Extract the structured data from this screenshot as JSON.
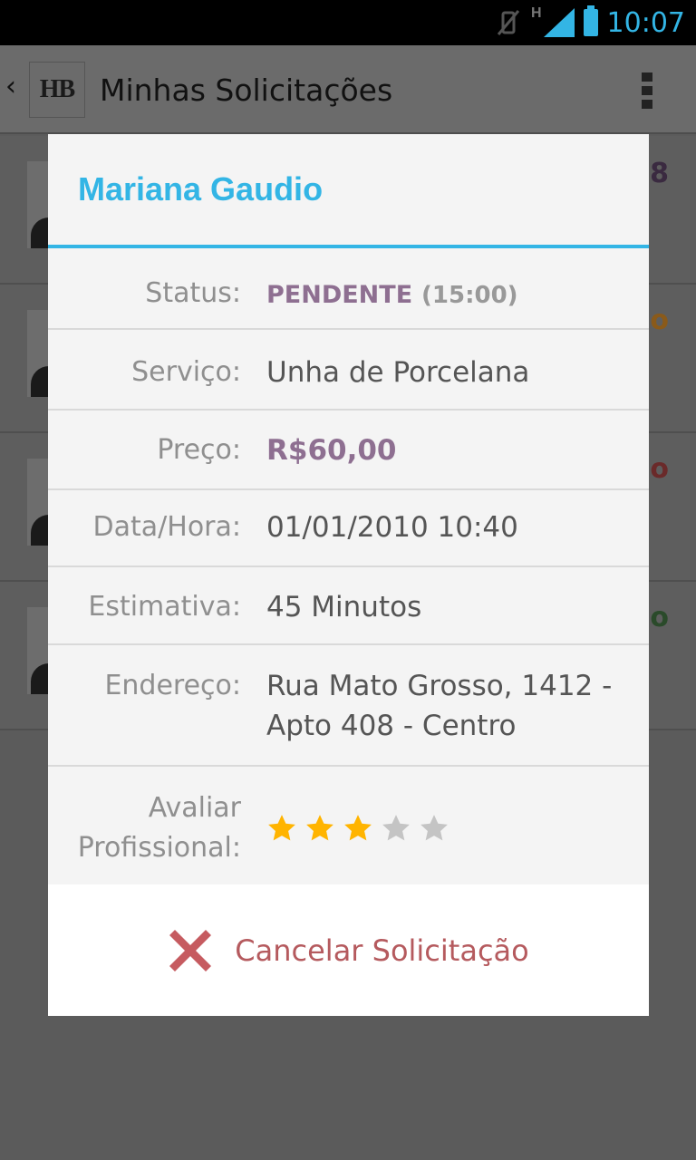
{
  "status_bar": {
    "time": "10:07",
    "network_type": "H",
    "icons": [
      "vibrate-off-icon",
      "signal-icon",
      "battery-icon"
    ]
  },
  "action_bar": {
    "logo_text": "HB",
    "title": "Minhas Solicitações",
    "icons": [
      "back-chevron-icon",
      "overflow-menu-icon"
    ]
  },
  "background_list": {
    "partial_marks": [
      "8",
      "o",
      "o",
      "o"
    ]
  },
  "dialog": {
    "title": "Mariana Gaudio",
    "fields": {
      "status": {
        "label": "Status:",
        "value": "PENDENTE",
        "time": "(15:00)"
      },
      "servico": {
        "label": "Serviço:",
        "value": "Unha de Porcelana"
      },
      "preco": {
        "label": "Preço:",
        "value": "R$60,00"
      },
      "data_hora": {
        "label": "Data/Hora:",
        "value": "01/01/2010 10:40"
      },
      "estimativa": {
        "label": "Estimativa:",
        "value": "45 Minutos"
      },
      "endereco": {
        "label": "Endereço:",
        "value": "Rua Mato Grosso, 1412 - Apto 408 - Centro"
      },
      "avaliar": {
        "label_line1": "Avaliar",
        "label_line2": "Profissional:",
        "rating": 3,
        "max_rating": 5
      }
    },
    "cancel": {
      "label": "Cancelar Solicitação",
      "icon": "cancel-x-icon"
    }
  },
  "colors": {
    "accent": "#33b5e5",
    "status_purple": "#8e6f91",
    "cancel_red": "#b55a5e",
    "star_on": "#ffb400",
    "star_off": "#c4c4c4"
  }
}
